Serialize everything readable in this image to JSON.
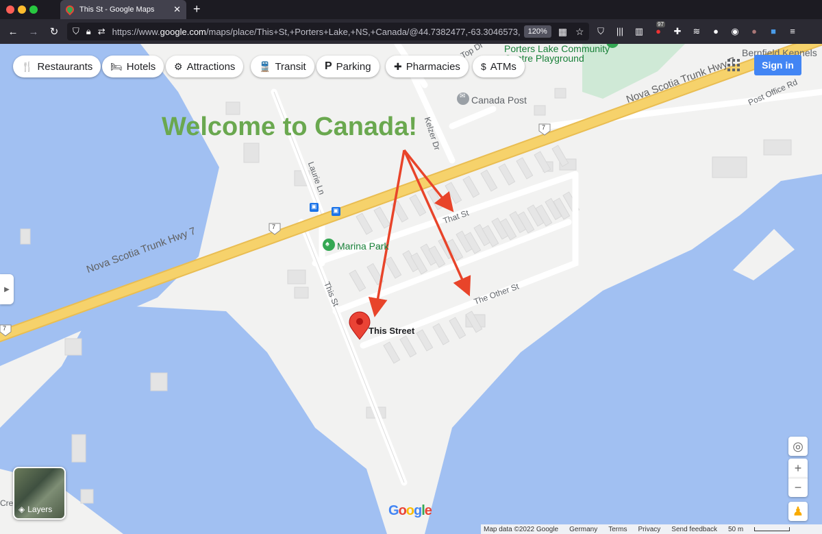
{
  "browser": {
    "tab_title": "This St - Google Maps",
    "url_prefix": "https://www.",
    "url_domain": "google.com",
    "url_rest": "/maps/place/This+St,+Porters+Lake,+NS,+Canada/@44.7382477,-63.3046573,17.71z",
    "zoom": "120%",
    "badge_count": "97"
  },
  "categories": [
    {
      "icon": "restaurant-icon",
      "glyph": "🍴",
      "label": "Restaurants"
    },
    {
      "icon": "hotel-icon",
      "glyph": "🛏",
      "label": "Hotels"
    },
    {
      "icon": "attractions-icon",
      "glyph": "⚙",
      "label": "Attractions"
    },
    {
      "icon": "transit-icon",
      "glyph": "🚆",
      "label": "Transit"
    },
    {
      "icon": "parking-icon",
      "glyph": "P",
      "label": "Parking"
    },
    {
      "icon": "pharmacy-icon",
      "glyph": "✚",
      "label": "Pharmacies"
    },
    {
      "icon": "atm-icon",
      "glyph": "$",
      "label": "ATMs"
    }
  ],
  "sign_in": "Sign in",
  "map": {
    "annotation": "Welcome to Canada!",
    "pin_label": "This Street",
    "highway_label": "Nova Scotia Trunk Hwy 7",
    "highway_shield": "7",
    "streets": {
      "that_st": "That St",
      "other_st": "The Other St",
      "this_st": "This St",
      "laurie_ln": "Laurie Ln",
      "kelzer_dr": "Kelzer Dr",
      "post_office_rd": "Post Office Rd",
      "top_dr": "Top Dr"
    },
    "places": {
      "community_centre": "Porters Lake Community Centre Playground",
      "canada_post": "Canada Post",
      "marina_park": "Marina Park",
      "bernfield": "Bernfield Kennels"
    },
    "left_edge_label": "Cres",
    "colors": {
      "water": "#a1c0f2",
      "land": "#f2f2f1",
      "highway": "#f6d26b",
      "park": "#cfe9d6",
      "pin": "#ea4335",
      "annotation": "#6aa84f",
      "arrow": "#e8442a"
    }
  },
  "controls": {
    "layers": "Layers",
    "zoom_in": "+",
    "zoom_out": "−"
  },
  "google_logo": [
    "G",
    "o",
    "o",
    "g",
    "l",
    "e"
  ],
  "footer": {
    "map_data": "Map data ©2022 Google",
    "country": "Germany",
    "terms": "Terms",
    "privacy": "Privacy",
    "feedback": "Send feedback",
    "scale": "50 m"
  }
}
